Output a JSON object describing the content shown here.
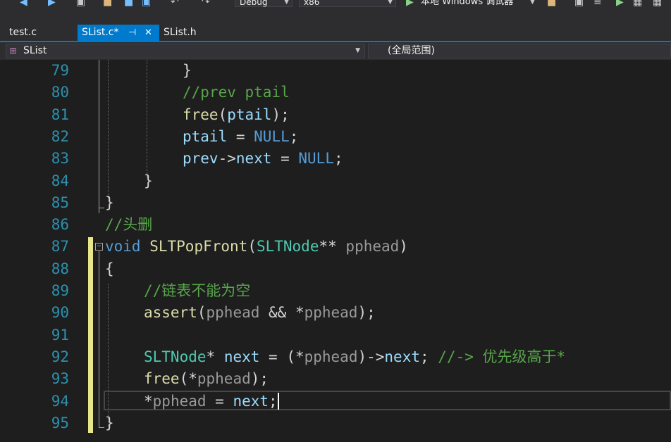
{
  "toolbar": {
    "config": "Debug",
    "platform": "x86",
    "run_label": "本地 Windows 调试器"
  },
  "tabs": [
    {
      "label": "test.c",
      "active": false
    },
    {
      "label": "SList.c*",
      "active": true
    },
    {
      "label": "SList.h",
      "active": false
    }
  ],
  "navbar": {
    "scope": "SList",
    "member": "(全局范围)"
  },
  "editor": {
    "lines": [
      {
        "no": "79",
        "tokens": [
          {
            "t": "}",
            "k": "p"
          }
        ]
      },
      {
        "no": "80",
        "tokens": [
          {
            "t": "//prev ptail",
            "k": "cm"
          }
        ]
      },
      {
        "no": "81",
        "tokens": [
          {
            "t": "free",
            "k": "fn"
          },
          {
            "t": "(",
            "k": "p"
          },
          {
            "t": "ptail",
            "k": "var"
          },
          {
            "t": ");",
            "k": "p"
          }
        ]
      },
      {
        "no": "82",
        "tokens": [
          {
            "t": "ptail",
            "k": "var"
          },
          {
            "t": " = ",
            "k": "p"
          },
          {
            "t": "NULL",
            "k": "mac"
          },
          {
            "t": ";",
            "k": "p"
          }
        ]
      },
      {
        "no": "83",
        "tokens": [
          {
            "t": "prev",
            "k": "var"
          },
          {
            "t": "->",
            "k": "p"
          },
          {
            "t": "next",
            "k": "var"
          },
          {
            "t": " = ",
            "k": "p"
          },
          {
            "t": "NULL",
            "k": "mac"
          },
          {
            "t": ";",
            "k": "p"
          }
        ]
      },
      {
        "no": "84",
        "tokens": [
          {
            "t": "}",
            "k": "p"
          }
        ]
      },
      {
        "no": "85",
        "tokens": [
          {
            "t": "}",
            "k": "p"
          }
        ]
      },
      {
        "no": "86",
        "tokens": [
          {
            "t": "//头删",
            "k": "cm"
          }
        ]
      },
      {
        "no": "87",
        "tokens": [
          {
            "t": "void",
            "k": "kw"
          },
          {
            "t": " ",
            "k": "p"
          },
          {
            "t": "SLTPopFront",
            "k": "fn"
          },
          {
            "t": "(",
            "k": "p"
          },
          {
            "t": "SLTNode",
            "k": "ty"
          },
          {
            "t": "** ",
            "k": "p"
          },
          {
            "t": "pphead",
            "k": "par"
          },
          {
            "t": ")",
            "k": "p"
          }
        ]
      },
      {
        "no": "88",
        "tokens": [
          {
            "t": "{",
            "k": "p"
          }
        ]
      },
      {
        "no": "89",
        "tokens": [
          {
            "t": "//链表不能为空",
            "k": "cm"
          }
        ]
      },
      {
        "no": "90",
        "tokens": [
          {
            "t": "assert",
            "k": "fn"
          },
          {
            "t": "(",
            "k": "p"
          },
          {
            "t": "pphead",
            "k": "par"
          },
          {
            "t": " && *",
            "k": "p"
          },
          {
            "t": "pphead",
            "k": "par"
          },
          {
            "t": ");",
            "k": "p"
          }
        ]
      },
      {
        "no": "91",
        "tokens": []
      },
      {
        "no": "92",
        "tokens": [
          {
            "t": "SLTNode",
            "k": "ty"
          },
          {
            "t": "* ",
            "k": "p"
          },
          {
            "t": "next",
            "k": "var"
          },
          {
            "t": " = (*",
            "k": "p"
          },
          {
            "t": "pphead",
            "k": "par"
          },
          {
            "t": ")->",
            "k": "p"
          },
          {
            "t": "next",
            "k": "var"
          },
          {
            "t": "; ",
            "k": "p"
          },
          {
            "t": "//-> 优先级高于*",
            "k": "cm"
          }
        ]
      },
      {
        "no": "93",
        "tokens": [
          {
            "t": "free",
            "k": "fn"
          },
          {
            "t": "(*",
            "k": "p"
          },
          {
            "t": "pphead",
            "k": "par"
          },
          {
            "t": ");",
            "k": "p"
          }
        ]
      },
      {
        "no": "94",
        "tokens": [
          {
            "t": "*",
            "k": "p"
          },
          {
            "t": "pphead",
            "k": "par"
          },
          {
            "t": " = ",
            "k": "p"
          },
          {
            "t": "next",
            "k": "var"
          },
          {
            "t": ";",
            "k": "p"
          }
        ]
      },
      {
        "no": "95",
        "tokens": [
          {
            "t": "}",
            "k": "p"
          }
        ]
      }
    ]
  }
}
